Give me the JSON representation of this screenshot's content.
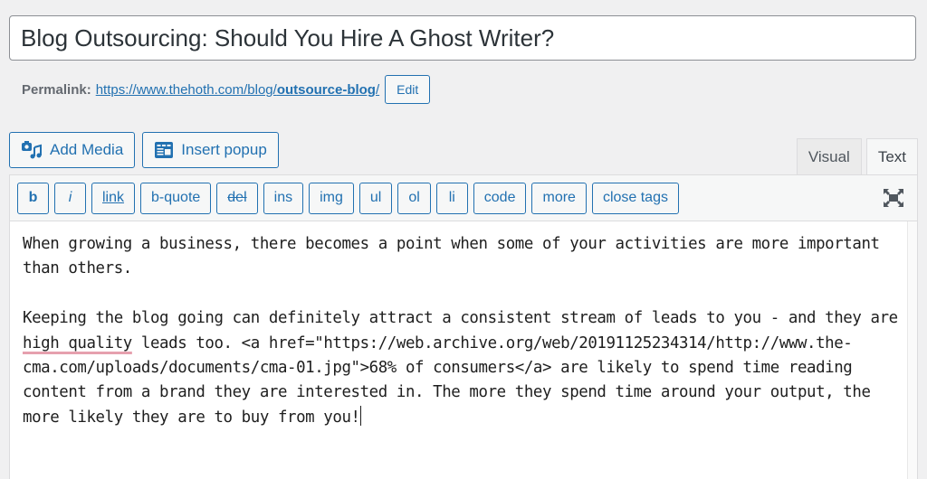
{
  "post": {
    "title": "Blog Outsourcing: Should You Hire A Ghost Writer?"
  },
  "permalink": {
    "label": "Permalink:",
    "url_base": "https://www.thehoth.com/blog/",
    "slug": "outsource-blog",
    "trailing": "/",
    "edit_label": "Edit"
  },
  "media_buttons": [
    {
      "label": "Add Media",
      "icon": "add-media-icon"
    },
    {
      "label": "Insert popup",
      "icon": "insert-popup-icon"
    }
  ],
  "tabs": [
    {
      "label": "Visual",
      "active": false
    },
    {
      "label": "Text",
      "active": true
    }
  ],
  "quicktags": [
    {
      "label": "b"
    },
    {
      "label": "i"
    },
    {
      "label": "link"
    },
    {
      "label": "b-quote"
    },
    {
      "label": "del"
    },
    {
      "label": "ins"
    },
    {
      "label": "img"
    },
    {
      "label": "ul"
    },
    {
      "label": "ol"
    },
    {
      "label": "li"
    },
    {
      "label": "code"
    },
    {
      "label": "more"
    },
    {
      "label": "close tags"
    }
  ],
  "editor": {
    "para1": "When growing a business, there becomes a point when some of your activities are more important than others.",
    "para2_before": "Keeping the blog going can definitely attract a consistent stream of leads to you - and they are ",
    "para2_spell": "high quality",
    "para2_after": " leads too. <a href=\"https://web.archive.org/web/20191125234314/http://www.the-cma.com/uploads/documents/cma-01.jpg\">68% of consumers</a> are likely to spend time reading content from a brand they are interested in. The more they spend time around your output, the more likely they are to buy from you!"
  },
  "colors": {
    "accent": "#2271b1",
    "background": "#f0f0f1",
    "spellcheck": "#e6a0ae"
  }
}
